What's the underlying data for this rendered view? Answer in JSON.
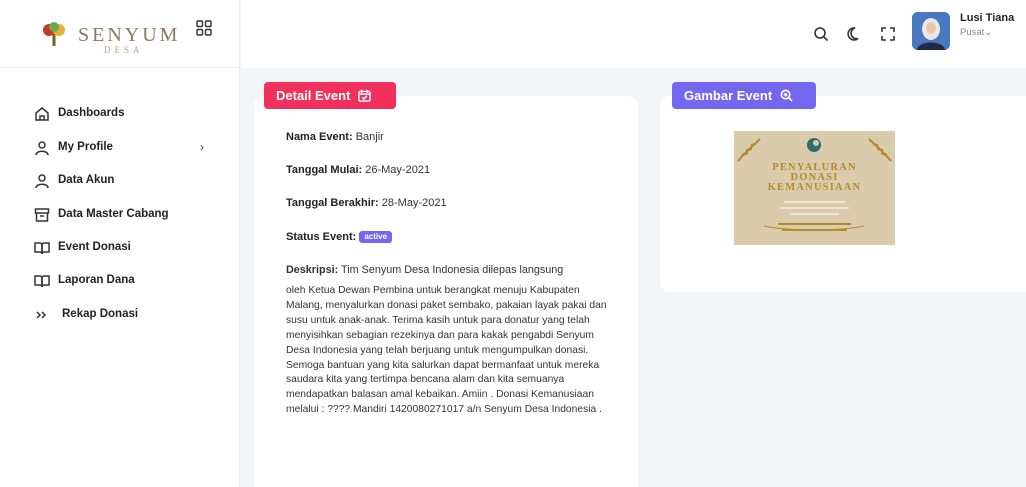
{
  "brand": {
    "name": "SENYUM",
    "sub": "DESA"
  },
  "sidebar": {
    "items": [
      {
        "label": "Dashboards",
        "icon": "home-icon"
      },
      {
        "label": "My Profile",
        "icon": "user-icon",
        "chevron": "›"
      },
      {
        "label": "Data Akun",
        "icon": "user-icon"
      },
      {
        "label": "Data Master Cabang",
        "icon": "archive-icon"
      },
      {
        "label": "Event Donasi",
        "icon": "book-icon"
      },
      {
        "label": "Laporan Dana",
        "icon": "book-icon"
      },
      {
        "label": "Rekap Donasi",
        "icon": "chevrons-right-icon"
      }
    ]
  },
  "header": {
    "user_name": "Lusi Tiana",
    "user_role": "Pusat⌄"
  },
  "detail": {
    "title": "Detail Event",
    "nama_label": "Nama Event:",
    "nama_value": " Banjir",
    "mulai_label": "Tanggal Mulai:",
    "mulai_value": " 26-May-2021",
    "berakhir_label": "Tanggal Berakhir:",
    "berakhir_value": " 28-May-2021",
    "status_label": "Status Event:",
    "status_value": "active",
    "desc_label": "Deskripsi:",
    "desc_first": " Tim Senyum Desa Indonesia dilepas langsung",
    "desc_body": "oleh Ketua Dewan Pembina untuk berangkat menuju Kabupaten Malang, menyalurkan donasi paket sembako, pakaian layak pakai dan susu untuk anak-anak. Terima kasih untuk para donatur yang telah menyisihkan sebagian rezekinya dan para kakak pengabdi Senyum Desa Indonesia yang telah berjuang untuk mengumpulkan donasi. Semoga bantuan yang kita salurkan dapat bermanfaat untuk mereka saudara kita yang tertimpa bencana alam dan kita semuanya mendapatkan balasan amal kebaikan. Amiin . Donasi Kemanusiaan melalui : ???? Mandiri 1420080271017 a/n Senyum Desa Indonesia ."
  },
  "gambar": {
    "title": "Gambar Event",
    "poster_line1": "PENYALURAN",
    "poster_line2": "DONASI",
    "poster_line3": "KEMANUSIAAN"
  },
  "colors": {
    "red": "#f1305c",
    "purple": "#7367f0",
    "gold": "#b58a2c"
  }
}
